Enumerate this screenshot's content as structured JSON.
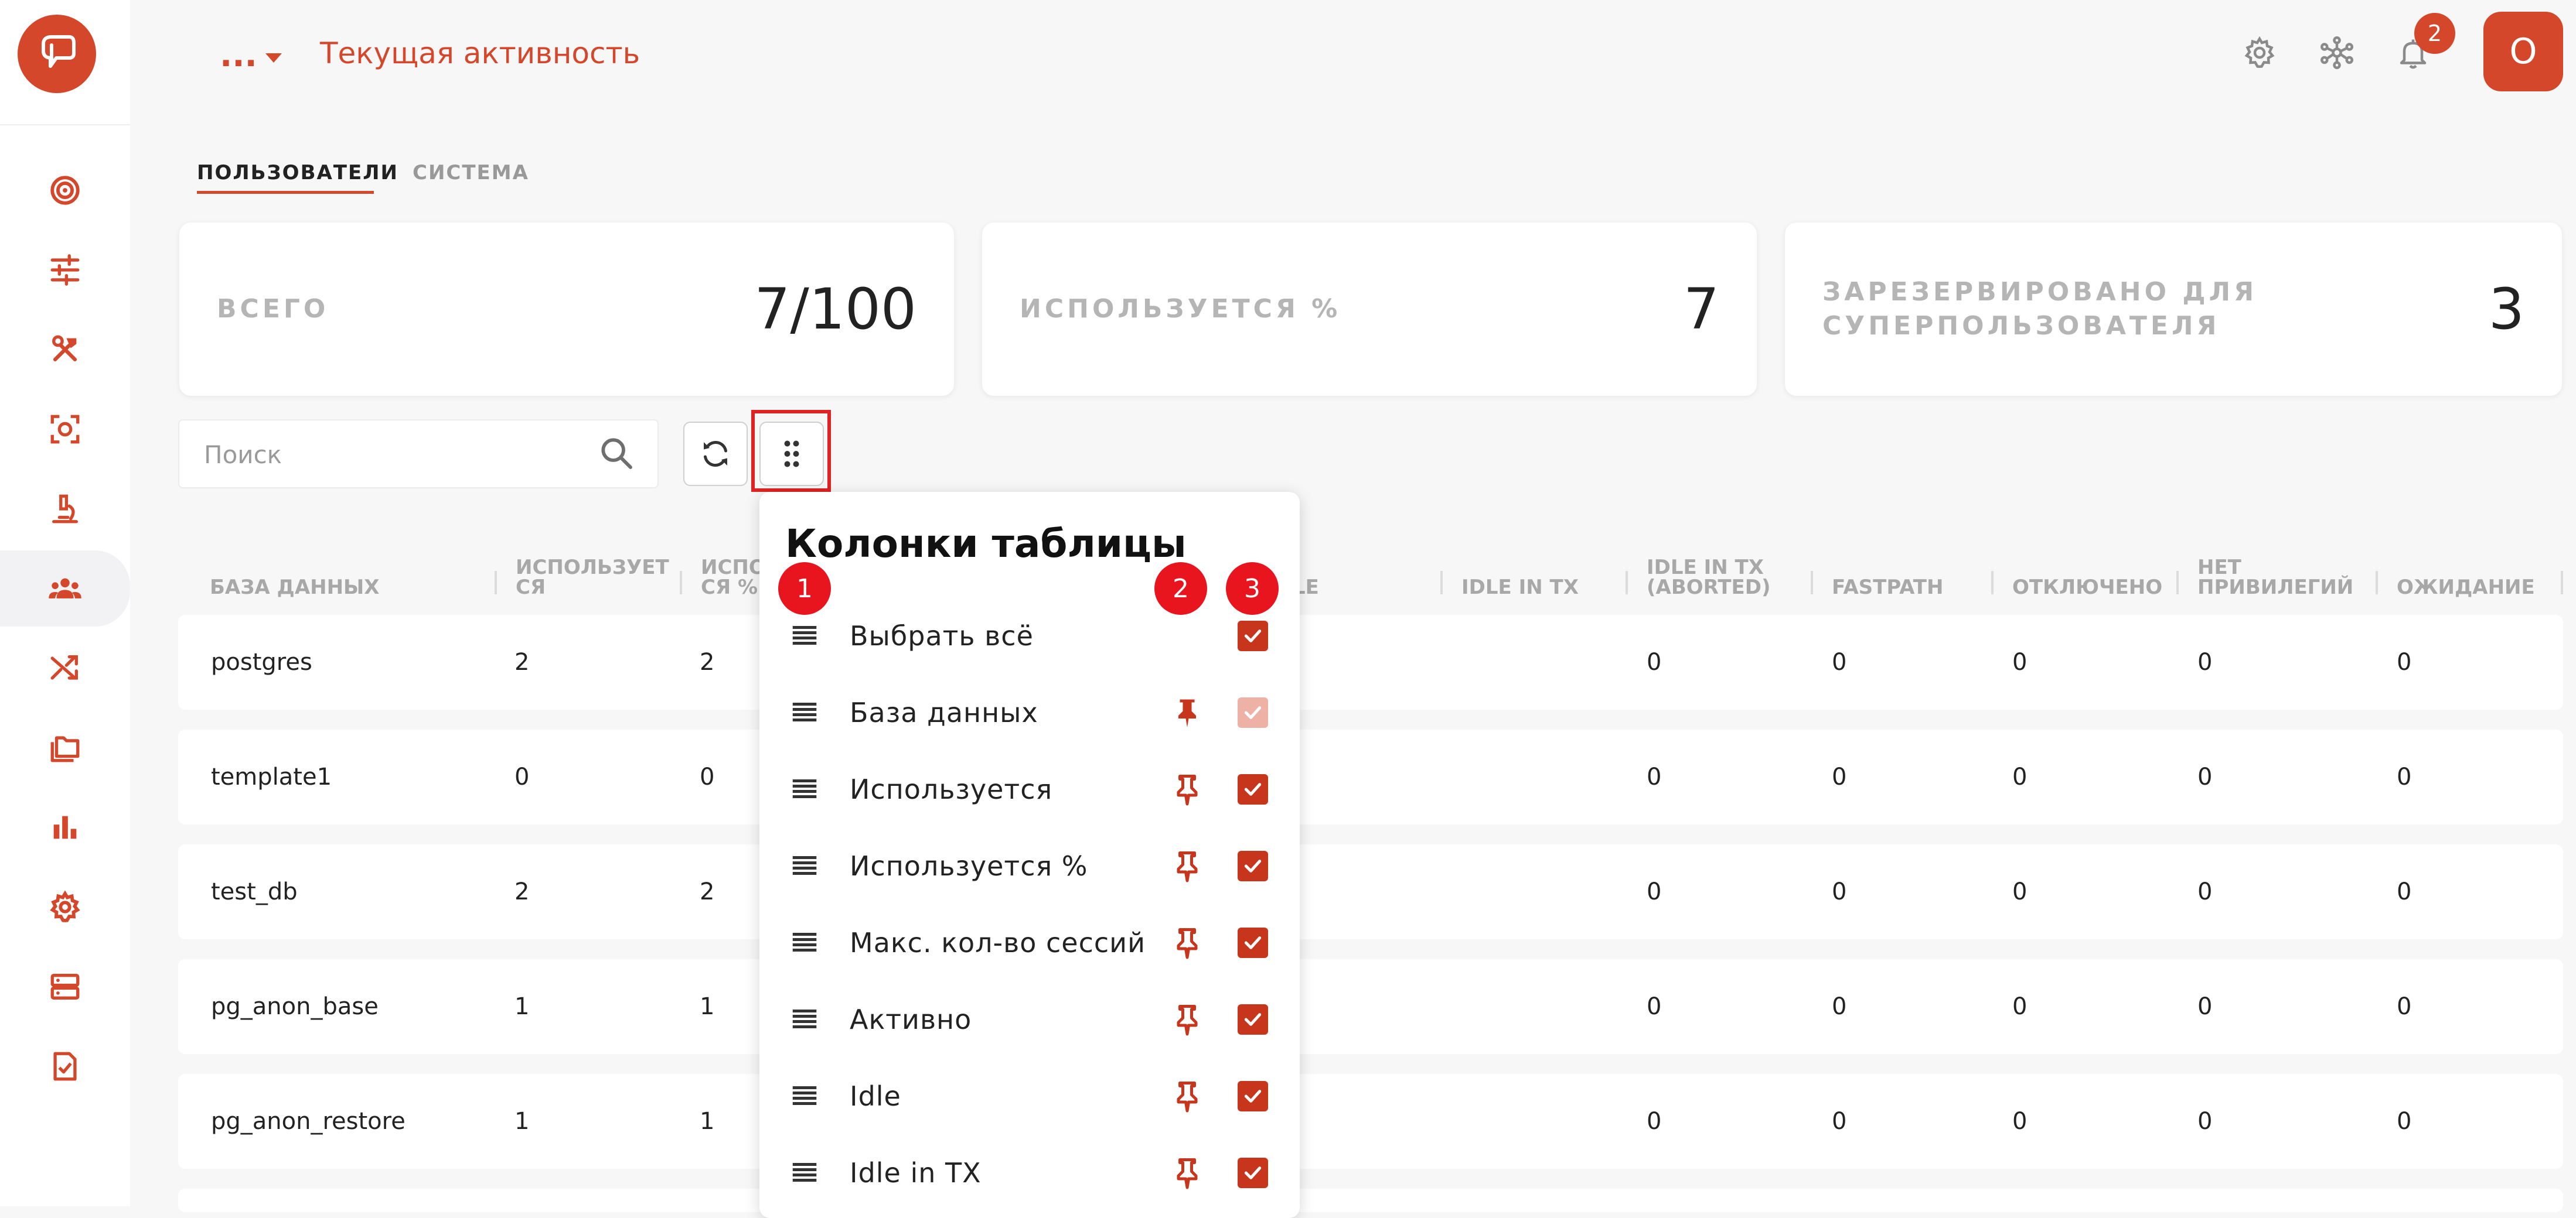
{
  "header": {
    "more_label": "...",
    "title": "Текущая активность",
    "notifications_count": "2",
    "avatar_initial": "О"
  },
  "sidebar": {
    "items": [
      {
        "icon": "target-icon",
        "active": false
      },
      {
        "icon": "sliders-icon",
        "active": false
      },
      {
        "icon": "tools-icon",
        "active": false
      },
      {
        "icon": "scan-icon",
        "active": false
      },
      {
        "icon": "microscope-icon",
        "active": false
      },
      {
        "icon": "users-icon",
        "active": true
      },
      {
        "icon": "shuffle-icon",
        "active": false
      },
      {
        "icon": "folders-icon",
        "active": false
      },
      {
        "icon": "bar-chart-icon",
        "active": false
      },
      {
        "icon": "gear-icon",
        "active": false
      },
      {
        "icon": "server-icon",
        "active": false
      },
      {
        "icon": "checklist-icon",
        "active": false
      }
    ]
  },
  "tabs": [
    {
      "label": "ПОЛЬЗОВАТЕЛИ",
      "active": true
    },
    {
      "label": "СИСТЕМА",
      "active": false
    }
  ],
  "cards": [
    {
      "label": "ВСЕГО",
      "value": "7/100"
    },
    {
      "label": "ИСПОЛЬЗУЕТСЯ %",
      "value": "7"
    },
    {
      "label_line1": "ЗАРЕЗЕРВИРОВАНО ДЛЯ",
      "label_line2": "СУПЕРПОЛЬЗОВАТЕЛЯ",
      "value": "3"
    }
  ],
  "search": {
    "placeholder": "Поиск",
    "value": ""
  },
  "table": {
    "headers": {
      "database": "БАЗА ДАННЫХ",
      "used_l1": "ИСПОЛЬЗУЕТ",
      "used_l2": "СЯ",
      "usedpct_l1": "ИСПО",
      "usedpct_l2": "СЯ %",
      "idle_partial": "LE",
      "idle_in_tx": "IDLE IN TX",
      "idle_in_tx_aborted_l1": "IDLE IN TX",
      "idle_in_tx_aborted_l2": "(ABORTED)",
      "fastpath": "FASTPATH",
      "disabled": "ОТКЛЮЧЕНО",
      "no_priv_l1": "НЕТ",
      "no_priv_l2": "ПРИВИЛЕГИЙ",
      "waiting": "ОЖИДАНИЕ"
    },
    "rows": [
      {
        "database": "postgres",
        "used": "2",
        "used_pct": "2",
        "aborted": "0",
        "fastpath": "0",
        "disabled": "0",
        "no_priv": "0",
        "waiting": "0"
      },
      {
        "database": "template1",
        "used": "0",
        "used_pct": "0",
        "aborted": "0",
        "fastpath": "0",
        "disabled": "0",
        "no_priv": "0",
        "waiting": "0"
      },
      {
        "database": "test_db",
        "used": "2",
        "used_pct": "2",
        "aborted": "0",
        "fastpath": "0",
        "disabled": "0",
        "no_priv": "0",
        "waiting": "0"
      },
      {
        "database": "pg_anon_base",
        "used": "1",
        "used_pct": "1",
        "aborted": "0",
        "fastpath": "0",
        "disabled": "0",
        "no_priv": "0",
        "waiting": "0"
      },
      {
        "database": "pg_anon_restore",
        "used": "1",
        "used_pct": "1",
        "aborted": "0",
        "fastpath": "0",
        "disabled": "0",
        "no_priv": "0",
        "waiting": "0"
      }
    ]
  },
  "column_menu": {
    "title": "Колонки таблицы",
    "items": [
      {
        "label": "Выбрать всё",
        "pin": false,
        "checked": true,
        "disabled": false
      },
      {
        "label": "База данных",
        "pin": true,
        "pinned": true,
        "checked": true,
        "disabled": true
      },
      {
        "label": "Используется",
        "pin": true,
        "checked": true,
        "disabled": false
      },
      {
        "label": "Используется %",
        "pin": true,
        "checked": true,
        "disabled": false
      },
      {
        "label": "Макс. кол-во сессий",
        "pin": true,
        "checked": true,
        "disabled": false
      },
      {
        "label": "Активно",
        "pin": true,
        "checked": true,
        "disabled": false
      },
      {
        "label": "Idle",
        "pin": true,
        "checked": true,
        "disabled": false
      },
      {
        "label": "Idle in TX",
        "pin": true,
        "checked": true,
        "disabled": false
      }
    ]
  },
  "annotations": {
    "badge1": "1",
    "badge2": "2",
    "badge3": "3"
  },
  "colors": {
    "accent": "#d4472a",
    "badge_red": "#e8141e",
    "checkbox": "#c8351d"
  }
}
